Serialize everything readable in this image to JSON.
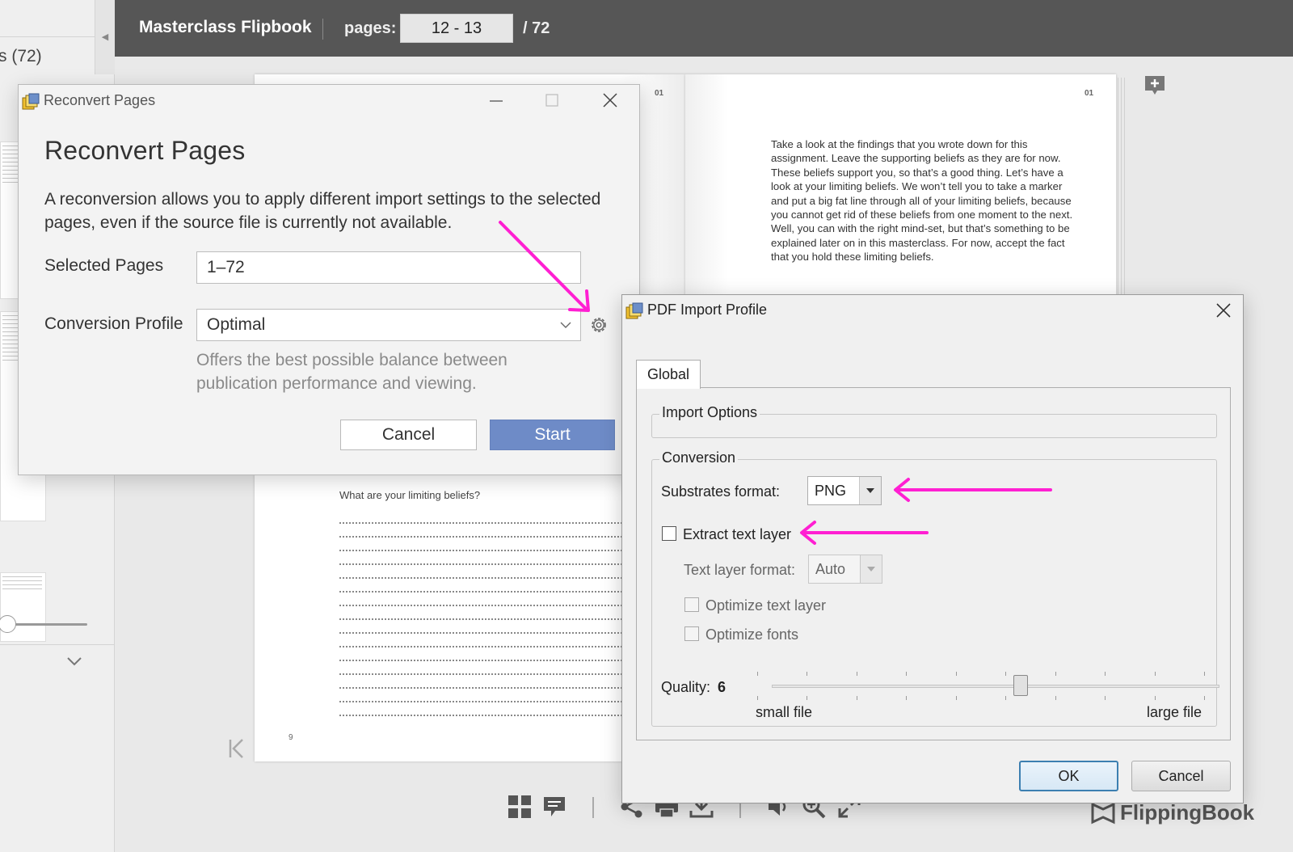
{
  "sidebar": {
    "pages_label": "s (72)"
  },
  "header": {
    "title": "Masterclass Flipbook",
    "pages_label": "pages:",
    "page_range": "12 - 13",
    "page_total": "/  72"
  },
  "book": {
    "left_page_number": "01",
    "right_page_number": "01",
    "right_page_text": "Take a look at the findings that you wrote down for this assignment. Leave the supporting beliefs as they are for now. These beliefs support you, so that’s a good thing. Let’s have a look at your limiting beliefs. We won’t tell you to take a marker and put a big fat line through all of your limiting beliefs, because you cannot get rid of these beliefs from one moment to the next. Well, you can with the right mind-set, but that’s something to be explained later on in this masterclass. For now, accept the fact that you hold these limiting beliefs.",
    "left_page_question": "What are your limiting beliefs?",
    "left_page_footer": "9"
  },
  "reconvert_dialog": {
    "window_title": "Reconvert Pages",
    "heading": "Reconvert Pages",
    "description": "A reconversion allows you to apply different import settings to the selected pages, even if the source file is currently not available.",
    "selected_pages_label": "Selected Pages",
    "selected_pages_value": "1–72",
    "profile_label": "Conversion Profile",
    "profile_value": "Optimal",
    "profile_hint": "Offers the best possible balance between publication performance and viewing.",
    "cancel_label": "Cancel",
    "start_label": "Start"
  },
  "pdf_import_dialog": {
    "window_title": "PDF Import Profile",
    "tab_label": "Global",
    "import_options_legend": "Import Options",
    "conversion_legend": "Conversion",
    "substrates_label": "Substrates format:",
    "substrates_value": "PNG",
    "extract_text_label": "Extract text layer",
    "extract_text_checked": false,
    "text_layer_format_label": "Text layer format:",
    "text_layer_format_value": "Auto",
    "optimize_text_label": "Optimize text layer",
    "optimize_fonts_label": "Optimize fonts",
    "quality_label": "Quality:",
    "quality_value": "6",
    "slider_min_label": "small file",
    "slider_max_label": "large file",
    "ok_label": "OK",
    "cancel_label": "Cancel"
  },
  "branding": {
    "logo_text": "FlippingBook"
  },
  "colors": {
    "topbar": "#565656",
    "start_button": "#6e8bc7",
    "annotation_arrow": "#ff1fd2"
  }
}
